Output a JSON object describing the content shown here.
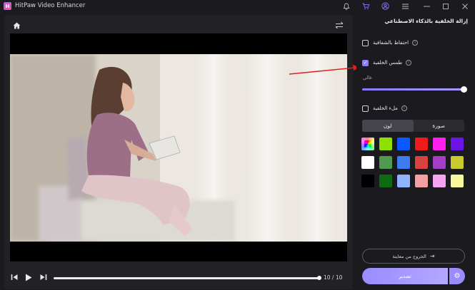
{
  "titlebar": {
    "app_title": "HitPaw Video Enhancer",
    "logo_letter": "H"
  },
  "player": {
    "time": "10 / 10",
    "progress": 1.0
  },
  "side": {
    "title": "إزالة الخلفية بالذكاء الاصطناعي",
    "options": [
      {
        "label": "احتفاظ بالشفافية",
        "checked": false
      },
      {
        "label": "طمس الخلفية",
        "checked": true
      },
      {
        "label": "ملء الخلفية",
        "checked": false
      }
    ],
    "level_label": "عالي",
    "blur_level": 1.0,
    "tabs": {
      "image": "صورة",
      "color": "لون",
      "active": "color"
    },
    "swatches": [
      "rainbow",
      "#8ee000",
      "#0a58ff",
      "#ee1b1b",
      "#ff1ef0",
      "#6a14e6",
      "#ffffff",
      "#4f9a4f",
      "#3b7cf0",
      "#d94040",
      "#a43dc7",
      "#c9c930",
      "#000000",
      "#0e6b10",
      "#8fb4ff",
      "#f4a0a0",
      "#f6a3f4",
      "#f6f69a"
    ],
    "exit_label": "الخروج من معاينة",
    "export_label": "تصدير"
  },
  "colors": {
    "accent": "#9a8cff",
    "annotation_arrow": "#e02020"
  }
}
